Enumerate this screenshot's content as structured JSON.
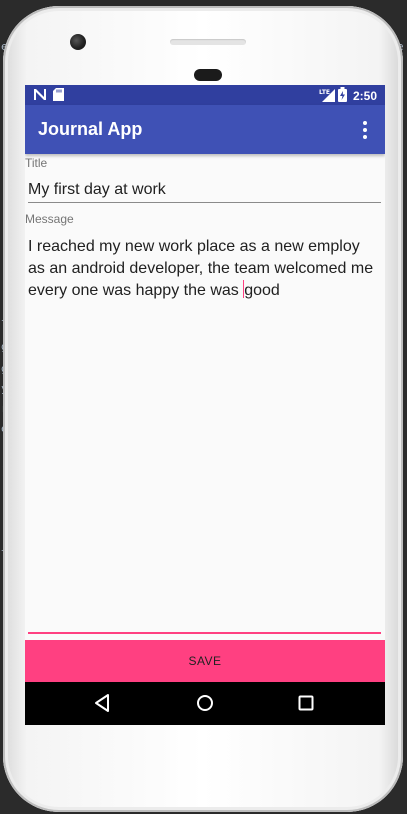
{
  "app": {
    "title": "Journal App"
  },
  "status_bar": {
    "time": "2:50",
    "network_label": "LTE",
    "icons": [
      "n-icon",
      "sd-card-icon",
      "lte-signal-icon",
      "battery-charging-icon"
    ]
  },
  "form": {
    "title_label": "Title",
    "title_value": "My first  day at work",
    "message_label": "Message",
    "message_before_cursor": "I reached my new work place as a new employ as an android developer, the team welcomed me every one was happy the was ",
    "message_after_cursor": "good"
  },
  "save_label": "SAVE",
  "nav": {
    "icons": [
      "back-icon",
      "home-icon",
      "recents-icon"
    ]
  },
  "colors": {
    "status_bar": "#303f9f",
    "toolbar": "#3f51b5",
    "accent": "#ff4081",
    "screen_bg": "#fafafa",
    "nav_bar": "#000000"
  }
}
